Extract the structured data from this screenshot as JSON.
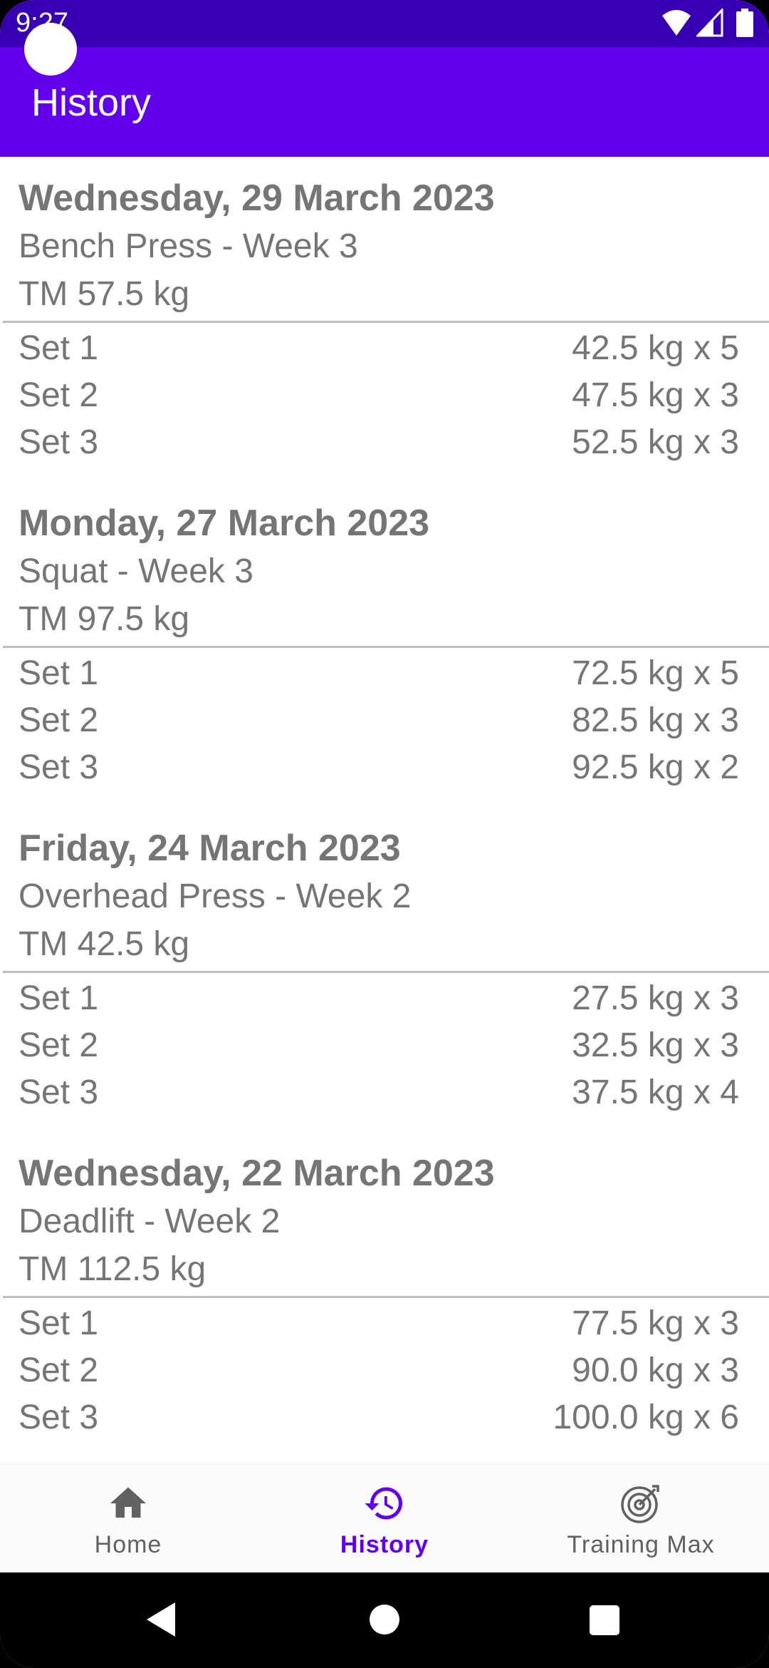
{
  "status_bar": {
    "time": "9:27"
  },
  "app_bar": {
    "title": "History"
  },
  "history": [
    {
      "date": "Wednesday, 29 March 2023",
      "exercise": "Bench Press - Week 3",
      "tm": "TM 57.5 kg",
      "sets": [
        {
          "label": "Set 1",
          "value": "42.5 kg x 5"
        },
        {
          "label": "Set 2",
          "value": "47.5 kg x 3"
        },
        {
          "label": "Set 3",
          "value": "52.5 kg x 3"
        }
      ]
    },
    {
      "date": "Monday, 27 March 2023",
      "exercise": "Squat - Week 3",
      "tm": "TM 97.5 kg",
      "sets": [
        {
          "label": "Set 1",
          "value": "72.5 kg x 5"
        },
        {
          "label": "Set 2",
          "value": "82.5 kg x 3"
        },
        {
          "label": "Set 3",
          "value": "92.5 kg x 2"
        }
      ]
    },
    {
      "date": "Friday, 24 March 2023",
      "exercise": "Overhead Press - Week 2",
      "tm": "TM 42.5 kg",
      "sets": [
        {
          "label": "Set 1",
          "value": "27.5 kg x 3"
        },
        {
          "label": "Set 2",
          "value": "32.5 kg x 3"
        },
        {
          "label": "Set 3",
          "value": "37.5 kg x 4"
        }
      ]
    },
    {
      "date": "Wednesday, 22 March 2023",
      "exercise": "Deadlift - Week 2",
      "tm": "TM 112.5 kg",
      "sets": [
        {
          "label": "Set 1",
          "value": "77.5 kg x 3"
        },
        {
          "label": "Set 2",
          "value": "90.0 kg x 3"
        },
        {
          "label": "Set 3",
          "value": "100.0 kg x 6"
        }
      ]
    }
  ],
  "bottom_nav": {
    "items": [
      {
        "label": "Home",
        "icon": "home-icon",
        "active": false
      },
      {
        "label": "History",
        "icon": "history-icon",
        "active": true
      },
      {
        "label": "Training Max",
        "icon": "target-icon",
        "active": false
      }
    ]
  },
  "colors": {
    "primary": "#6200ee",
    "primary_dark": "#3700b3",
    "text_secondary": "#757575"
  }
}
